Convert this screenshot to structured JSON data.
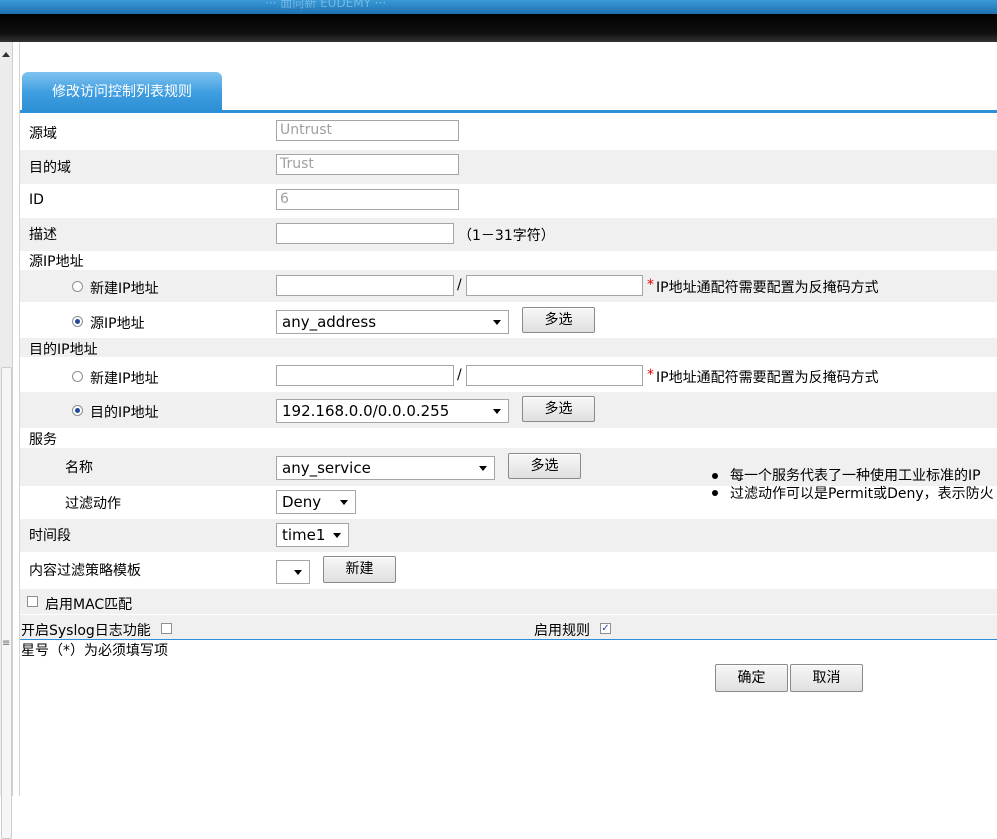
{
  "header": {
    "banner_text": "··· 面向新 EUDEMY ···"
  },
  "tab": {
    "title": "修改访问控制列表规则"
  },
  "form": {
    "source_zone": {
      "label": "源域",
      "value": "Untrust"
    },
    "dest_zone": {
      "label": "目的域",
      "value": "Trust"
    },
    "id": {
      "label": "ID",
      "value": "6"
    },
    "description": {
      "label": "描述",
      "value": "",
      "hint": "（1－31字符）"
    },
    "source_ip": {
      "section_label": "源IP地址",
      "new_label": "新建IP地址",
      "existing_label": "源IP地址",
      "slash": "/",
      "star": "*",
      "hint": "IP地址通配符需要配置为反掩码方式",
      "selected": "any_address",
      "multi_button": "多选"
    },
    "dest_ip": {
      "section_label": "目的IP地址",
      "new_label": "新建IP地址",
      "existing_label": "目的IP地址",
      "slash": "/",
      "star": "*",
      "hint": "IP地址通配符需要配置为反掩码方式",
      "selected": "192.168.0.0/0.0.0.255",
      "multi_button": "多选"
    },
    "service": {
      "section_label": "服务",
      "name_label": "名称",
      "selected": "any_service",
      "multi_button": "多选",
      "filter_label": "过滤动作",
      "filter_value": "Deny",
      "notes": [
        "每一个服务代表了一种使用工业标准的IP",
        "过滤动作可以是Permit或Deny，表示防火"
      ]
    },
    "time_range": {
      "label": "时间段",
      "value": "time1"
    },
    "content_filter": {
      "label": "内容过滤策略模板",
      "value": "",
      "new_button": "新建"
    },
    "mac_match": {
      "label": "启用MAC匹配",
      "checked": false
    },
    "syslog": {
      "label": "开启Syslog日志功能",
      "checked": false
    },
    "enable_rule": {
      "label": "启用规则",
      "checked": true,
      "mark": "✓"
    },
    "required_note": "星号（*）为必须填写项",
    "ok_button": "确定",
    "cancel_button": "取消"
  },
  "colors": {
    "accent": "#2d8fd5",
    "row_shade": "#f0f0f0",
    "required": "#e00000"
  }
}
